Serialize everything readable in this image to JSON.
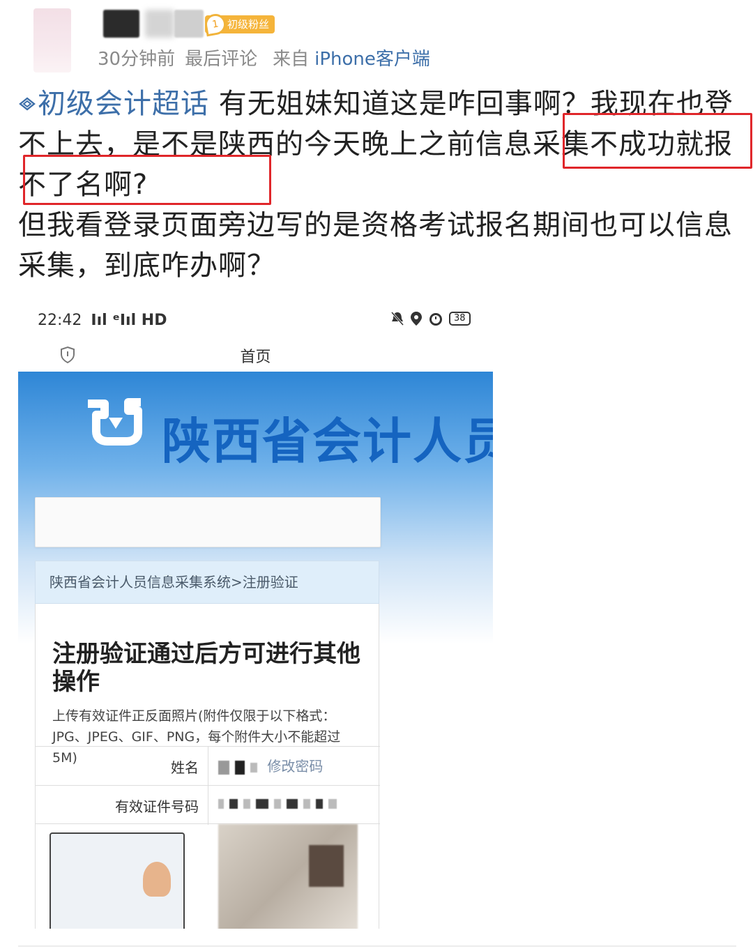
{
  "post": {
    "username": "",
    "fan_badge": {
      "level": "1",
      "label": "初级粉丝"
    },
    "meta": {
      "time": "30分钟前",
      "last_comment": "最后评论",
      "from_prefix": "来自",
      "source": "iPhone客户端"
    },
    "topic": "初级会计超话",
    "body_line1": " 有无姐妹知道这是咋回事啊？我现在也登不上去，是不是陕西的今天晚上之前",
    "body_highlight1": "信息采集不",
    "body_highlight2": "成功就报不了名啊",
    "body_after": "?",
    "body_para2": "但我看登录页面旁边写的是资格考试报名期间也可以信息采集，到底咋办啊？"
  },
  "screenshot": {
    "status_time": "22:42",
    "status_signal": "ⵏıl ᵉⵏıl HD",
    "battery": "38",
    "nav_title": "首页",
    "banner_title": "陕西省会计人员信",
    "breadcrumb": "陕西省会计人员信息采集系统>注册验证",
    "card_title": "注册验证通过后方可进行其他操作",
    "card_desc": "上传有效证件正反面照片(附件仅限于以下格式：JPG、JPEG、GIF、PNG，每个附件大小不能超过5M)",
    "rows": [
      {
        "label": "姓名",
        "value": "修改密码"
      },
      {
        "label": "有效证件号码",
        "value": ""
      }
    ]
  },
  "colors": {
    "link": "#3d6fa9",
    "highlight_box": "#e0262a",
    "badge": "#f5b43a",
    "banner_text": "#1564c0"
  }
}
